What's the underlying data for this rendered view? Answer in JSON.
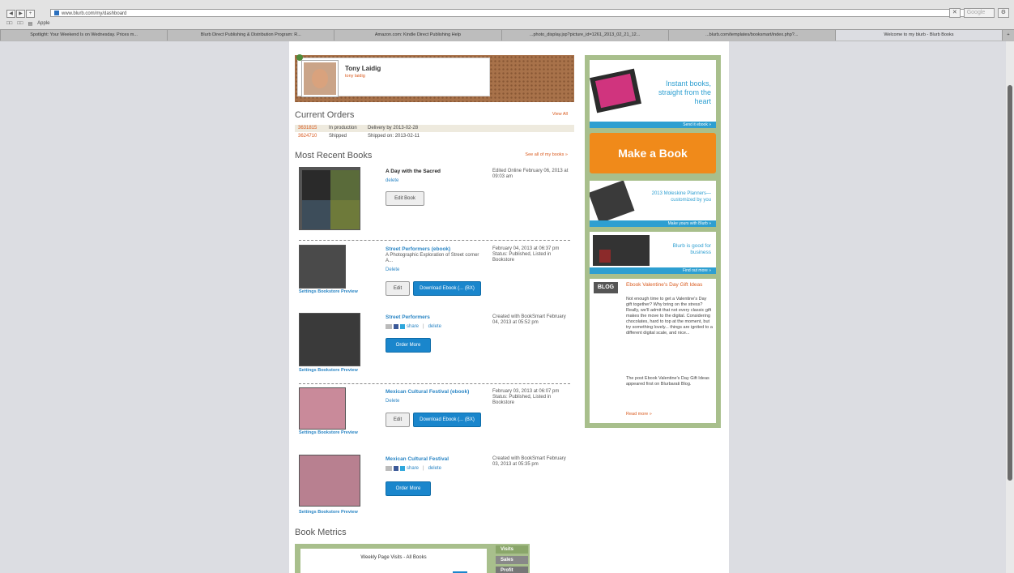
{
  "browser": {
    "url": "www.blurb.com/my/dashboard",
    "search_label": "Google",
    "bookmarks": [
      "□□",
      "□□",
      "▤",
      "Apple"
    ],
    "tabs": [
      "Spotlight: Your Weekend Is on Wednesday. Prices m...",
      "Blurb Direct Publishing & Distribution Program: R...",
      "Amazon.com: Kindle Direct Publishing Help",
      "...photo_display.jsp?picture_id=1261_2013_02_21_12...",
      "...blurb.com/templates/booksmart/index.php?...",
      "Welcome to my blurb - Blurb Books"
    ]
  },
  "profile": {
    "name": "Tony Laidig",
    "link": "tony laidig"
  },
  "orders": {
    "title": "Current Orders",
    "view_all": "View All",
    "rows": [
      {
        "id": "3631815",
        "status": "In production",
        "delivery": "Delivery by 2013-02-28"
      },
      {
        "id": "3624710",
        "status": "Shipped",
        "delivery": "Shipped on: 2013-02-11"
      }
    ]
  },
  "books_section": {
    "title": "Most Recent Books",
    "see_all": "See all of my books »"
  },
  "books": [
    {
      "title": "A Day with the Sacred",
      "action": "delete",
      "button": "Edit Book",
      "meta": "Edited Online February 06, 2013 at 09:03 am"
    },
    {
      "title": "Street Performers (ebook)",
      "desc": "A Photographic Exploration of Street corner A...",
      "action": "Delete",
      "button": "Edit",
      "button2": "Download Ebook (... (BX)",
      "meta": "February 04, 2013 at 06:37 pm Status: Published, Listed in Bookstore",
      "links": "Settings  Bookstore Preview"
    },
    {
      "title": "Street Performers",
      "share": "share",
      "delete": "delete",
      "button": "Order More",
      "meta": "Created with BookSmart February 04, 2013 at 05:52 pm",
      "links": "Settings  Bookstore Preview"
    },
    {
      "title": "Mexican Cultural Festival (ebook)",
      "action": "Delete",
      "button": "Edit",
      "button2": "Download Ebook (... (BX)",
      "meta": "February 03, 2013 at 06:07 pm Status: Published, Listed in Bookstore",
      "links": "Settings  Bookstore Preview"
    },
    {
      "title": "Mexican Cultural Festival",
      "share": "share",
      "delete": "delete",
      "button": "Order More",
      "meta": "Created with BookSmart February 03, 2013 at 05:35 pm",
      "links": "Settings  Bookstore Preview"
    }
  ],
  "sidebar": {
    "ad1": {
      "text": "Instant books, straight from the heart",
      "bar": "Send it ebook »"
    },
    "make_book": "Make a Book",
    "ad2": {
      "text": "2013 Moleskine Planners—customized by you",
      "bar": "Make yours with Blurb »"
    },
    "ad3": {
      "text": "Blurb is good for business",
      "bar": "Find out more »"
    },
    "blog": {
      "badge": "BLOG",
      "headline": "Ebook Valentine's Day Gift Ideas",
      "body": "Not enough time to get a Valentine's Day gift together? Why bring on the stress? Really, we'll admit that not every classic gift makes the move to the digital. Considering chocolates, hard to top at the moment, but try something lovely... things are ignited to a different digital scale, and nice...",
      "footer": "The post Ebook Valentine's Day Gift Ideas appeared first on Blurbarati Blog.",
      "more": "Read more »"
    }
  },
  "metrics": {
    "title": "Book Metrics",
    "chart_title": "Weekly Page Visits - All Books",
    "tabs": [
      "Visits",
      "Sales",
      "Profit"
    ]
  },
  "colors": {
    "accent_orange": "#f08a1a",
    "link_blue": "#2b86c5",
    "sidebar_green": "#a8bf8c"
  }
}
